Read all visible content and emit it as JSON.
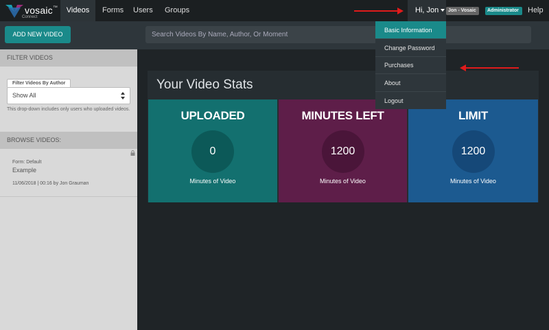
{
  "brand": {
    "name": "vosaic",
    "tm": "™",
    "sub": "Connect"
  },
  "nav": {
    "videos": "Videos",
    "forms": "Forms",
    "users": "Users",
    "groups": "Groups"
  },
  "user": {
    "greeting": "Hi, Jon",
    "badge_user": "Jon - Vosaic",
    "badge_role": "Administrator",
    "help": "Help"
  },
  "toolbar": {
    "add_video": "ADD NEW VIDEO",
    "search_placeholder": "Search Videos By Name, Author, Or Moment"
  },
  "sidebar": {
    "filter_heading": "FILTER VIDEOS",
    "filter_tab": "Filter Videos By Author",
    "filter_value": "Show All",
    "filter_hint": "This drop-down includes only users who uploaded videos.",
    "browse_heading": "BROWSE VIDEOS:",
    "video": {
      "form": "Form: Default",
      "title": "Example",
      "meta": "11/06/2018 | 00:16 by Jon Grauman"
    }
  },
  "stats": {
    "title": "Your Video Stats",
    "cards": [
      {
        "label": "UPLOADED",
        "value": "0",
        "sub": "Minutes of Video"
      },
      {
        "label": "MINUTES LEFT",
        "value": "1200",
        "sub": "Minutes of Video"
      },
      {
        "label": "LIMIT",
        "value": "1200",
        "sub": "Minutes of Video"
      }
    ]
  },
  "dropdown": [
    "Basic Information",
    "Change Password",
    "Purchases",
    "About",
    "Logout"
  ],
  "colors": {
    "accent": "#1a8a8a",
    "uploaded": "#13706f",
    "minutes_left": "#5e1e49",
    "limit": "#1c5a90",
    "annotation": "#e01b1b"
  },
  "icons": {
    "logo": "vosaic-logo-icon",
    "caret": "caret-down-icon",
    "select": "select-arrows-icon",
    "lock": "lock-icon"
  }
}
